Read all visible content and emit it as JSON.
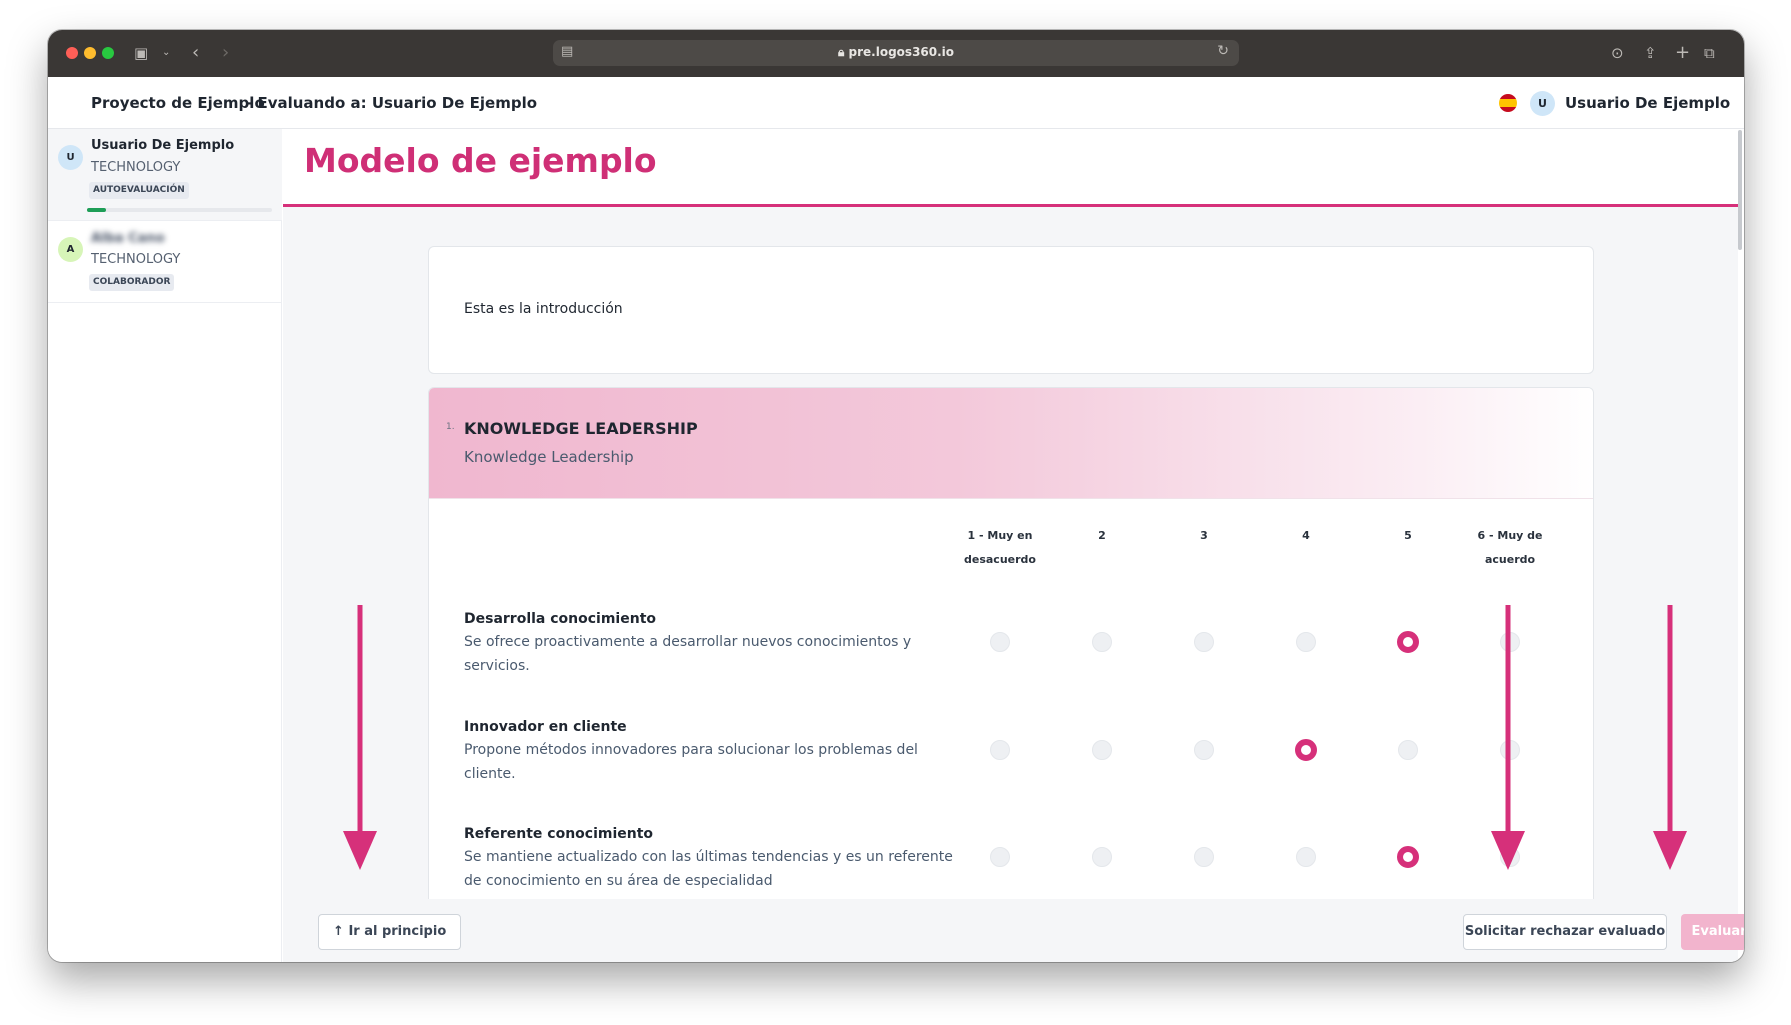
{
  "browser": {
    "url": "pre.logos360.io"
  },
  "header": {
    "project": "Proyecto de Ejemplo",
    "evaluating": "- Evaluando a: Usuario De Ejemplo",
    "user_initial": "U",
    "user_name": "Usuario De Ejemplo",
    "language_flag": "spain-flag-icon"
  },
  "sidebar": {
    "items": [
      {
        "initial": "U",
        "name": "Usuario De Ejemplo",
        "dept": "TECHNOLOGY",
        "badge": "AUTOEVALUACIÓN",
        "avatar_color": "#cfe6f8",
        "progress": 0.1
      },
      {
        "initial": "A",
        "name": "Alba Cano",
        "dept": "TECHNOLOGY",
        "badge": "COLABORADOR",
        "avatar_color": "#d7f5b8"
      }
    ]
  },
  "main": {
    "title": "Modelo de ejemplo",
    "intro": "Esta es la introducción",
    "section": {
      "number": "1.",
      "title": "KNOWLEDGE LEADERSHIP",
      "subtitle": "Knowledge Leadership"
    },
    "scale": [
      {
        "line1": "1 - Muy en",
        "line2": "desacuerdo"
      },
      {
        "line1": "2",
        "line2": ""
      },
      {
        "line1": "3",
        "line2": ""
      },
      {
        "line1": "4",
        "line2": ""
      },
      {
        "line1": "5",
        "line2": ""
      },
      {
        "line1": "6 - Muy de",
        "line2": "acuerdo"
      }
    ],
    "questions": [
      {
        "title": "Desarrolla conocimiento",
        "desc": "Se ofrece proactivamente a desarrollar nuevos conocimientos y servicios.",
        "selected": 5
      },
      {
        "title": "Innovador en cliente",
        "desc": "Propone métodos innovadores para solucionar los problemas del cliente.",
        "selected": 4
      },
      {
        "title": "Referente conocimiento",
        "desc": "Se mantiene actualizado con las últimas tendencias y es un referente de conocimiento en su área de especialidad",
        "selected": 5
      }
    ]
  },
  "footer": {
    "go_top": "Ir al principio",
    "reject": "Solicitar rechazar evaluado",
    "evaluate": "Evaluar"
  },
  "colors": {
    "accent": "#d6307a",
    "title": "#cf2f76",
    "evaluate_disabled": "#f2b4cd"
  }
}
